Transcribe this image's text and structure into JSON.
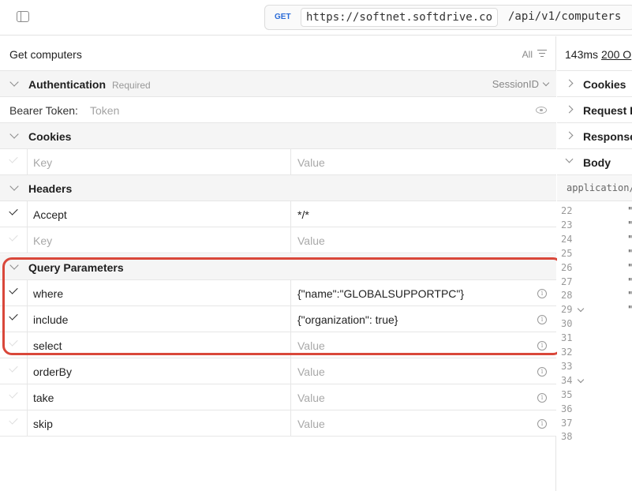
{
  "topbar": {
    "method": "GET",
    "base_url": "https://softnet.softdrive.co",
    "path": "/api/v1/computers"
  },
  "request": {
    "name": "Get computers",
    "filter_label": "All"
  },
  "auth": {
    "title": "Authentication",
    "required": "Required",
    "type": "SessionID",
    "token_label": "Bearer Token:",
    "token_placeholder": "Token"
  },
  "cookies": {
    "title": "Cookies",
    "rows": [
      {
        "key": "Key",
        "value": "Value",
        "placeholder": true,
        "checked": false
      }
    ]
  },
  "headers": {
    "title": "Headers",
    "rows": [
      {
        "key": "Accept",
        "value": "*/*",
        "placeholder": false,
        "checked": true
      },
      {
        "key": "Key",
        "value": "Value",
        "placeholder": true,
        "checked": false
      }
    ]
  },
  "query": {
    "title": "Query Parameters",
    "rows": [
      {
        "key": "where",
        "value": "{\"name\":\"GLOBALSUPPORTPC\"}",
        "checked": true,
        "value_placeholder": false
      },
      {
        "key": "include",
        "value": "{\"organization\": true}",
        "checked": true,
        "value_placeholder": false
      },
      {
        "key": "select",
        "value": "Value",
        "checked": false,
        "value_placeholder": true
      },
      {
        "key": "orderBy",
        "value": "Value",
        "checked": false,
        "value_placeholder": true
      },
      {
        "key": "take",
        "value": "Value",
        "checked": false,
        "value_placeholder": true
      },
      {
        "key": "skip",
        "value": "Value",
        "checked": false,
        "value_placeholder": true
      }
    ]
  },
  "response": {
    "time": "143ms",
    "status": "200 O",
    "sections": [
      "Cookies",
      "Request I",
      "Response",
      "Body"
    ],
    "content_type": "application/",
    "line_numbers": [
      "22",
      "23",
      "24",
      "25",
      "26",
      "27",
      "28",
      "29",
      "30",
      "31",
      "32",
      "33",
      "34",
      "35",
      "36",
      "37",
      "38"
    ],
    "folded_lines": [
      "29",
      "34"
    ],
    "quoted_lines": [
      "22",
      "23",
      "24",
      "25",
      "26",
      "27",
      "28",
      "29"
    ]
  },
  "colors": {
    "accent_method": "#2b6cd8",
    "highlight_border": "#d9473a"
  }
}
